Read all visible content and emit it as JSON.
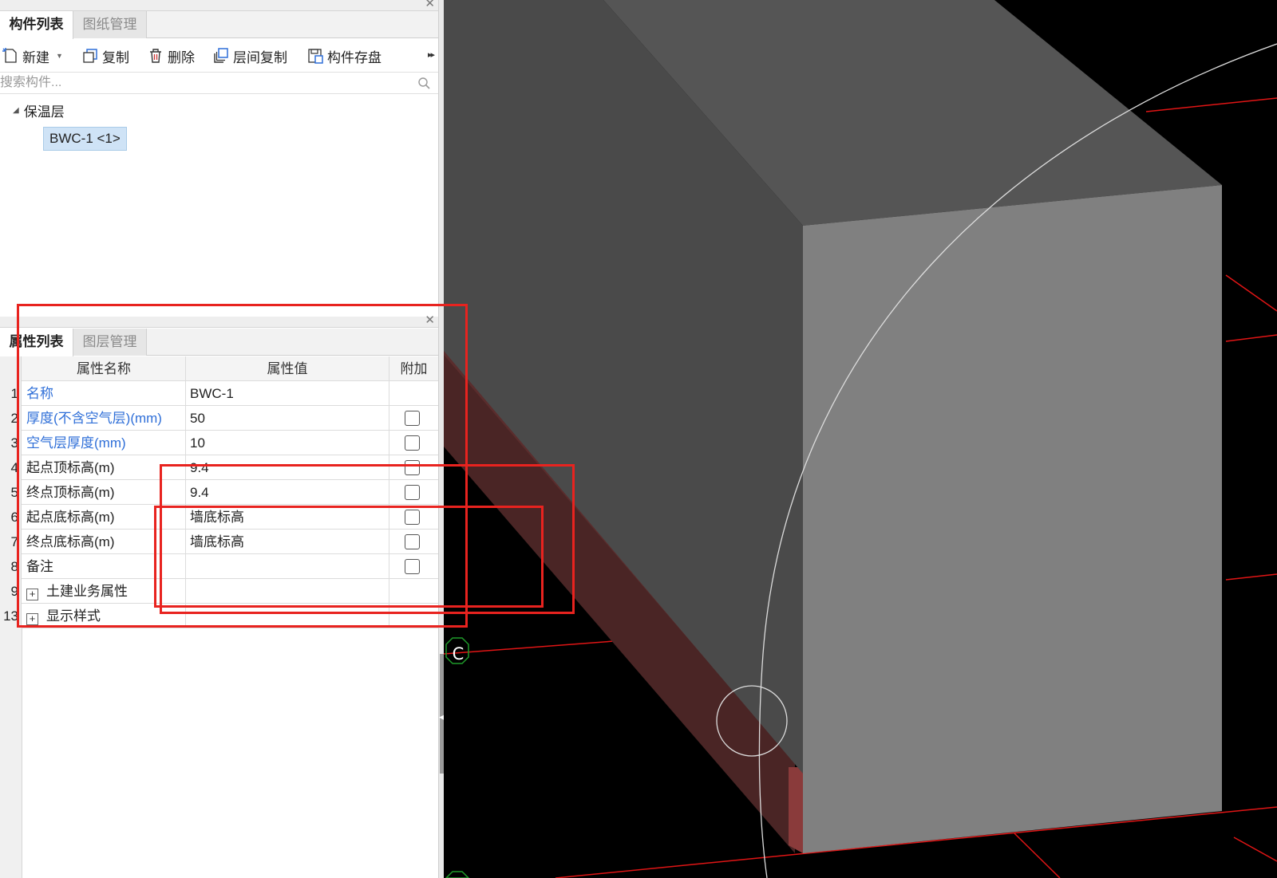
{
  "component_panel": {
    "tabs": [
      {
        "label": "构件列表",
        "active": true
      },
      {
        "label": "图纸管理",
        "active": false
      }
    ],
    "toolbar": {
      "new_label": "新建",
      "copy_label": "复制",
      "delete_label": "删除",
      "floor_copy_label": "层间复制",
      "save_label": "构件存盘"
    },
    "search": {
      "placeholder": "搜索构件..."
    },
    "tree": {
      "group_label": "保温层",
      "items": [
        {
          "label": "BWC-1 <1>",
          "selected": true
        }
      ]
    }
  },
  "property_panel": {
    "tabs": [
      {
        "label": "属性列表",
        "active": true
      },
      {
        "label": "图层管理",
        "active": false
      }
    ],
    "columns": {
      "name": "属性名称",
      "value": "属性值",
      "extra": "附加"
    },
    "rows": [
      {
        "num": "1",
        "name": "名称",
        "value": "BWC-1",
        "blue": true,
        "checkbox": false
      },
      {
        "num": "2",
        "name": "厚度(不含空气层)(mm)",
        "value": "50",
        "blue": true,
        "checkbox": true
      },
      {
        "num": "3",
        "name": "空气层厚度(mm)",
        "value": "10",
        "blue": true,
        "checkbox": true
      },
      {
        "num": "4",
        "name": "起点顶标高(m)",
        "value": "9.4",
        "blue": false,
        "checkbox": true
      },
      {
        "num": "5",
        "name": "终点顶标高(m)",
        "value": "9.4",
        "blue": false,
        "checkbox": true
      },
      {
        "num": "6",
        "name": "起点底标高(m)",
        "value": "墙底标高",
        "blue": false,
        "checkbox": true
      },
      {
        "num": "7",
        "name": "终点底标高(m)",
        "value": "墙底标高",
        "blue": false,
        "checkbox": true
      },
      {
        "num": "8",
        "name": "备注",
        "value": "",
        "blue": false,
        "checkbox": true
      },
      {
        "num": "9",
        "name": "土建业务属性",
        "value": "",
        "blue": false,
        "checkbox": false,
        "expander": "+"
      },
      {
        "num": "13",
        "name": "显示样式",
        "value": "",
        "blue": false,
        "checkbox": false,
        "expander": "+"
      }
    ]
  },
  "viewport": {
    "axis_label": "C"
  },
  "colors": {
    "accent_blue": "#2f6fd8",
    "annotation_red": "#e8231f",
    "selection_bg": "#cfe3f6",
    "grid_line_red": "#e01515",
    "insulation_layer": "#4a2525"
  }
}
